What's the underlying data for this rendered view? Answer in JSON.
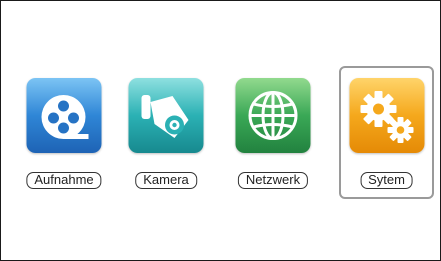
{
  "menu": {
    "items": [
      {
        "label": "Aufnahme",
        "icon": "film-reel-icon",
        "color": "#2f86d6"
      },
      {
        "label": "Kamera",
        "icon": "camera-icon",
        "color": "#2bb1b4"
      },
      {
        "label": "Netzwerk",
        "icon": "globe-icon",
        "color": "#3aa856"
      },
      {
        "label": "Sytem",
        "icon": "gears-icon",
        "color": "#f5a81c",
        "selected": true
      }
    ]
  }
}
